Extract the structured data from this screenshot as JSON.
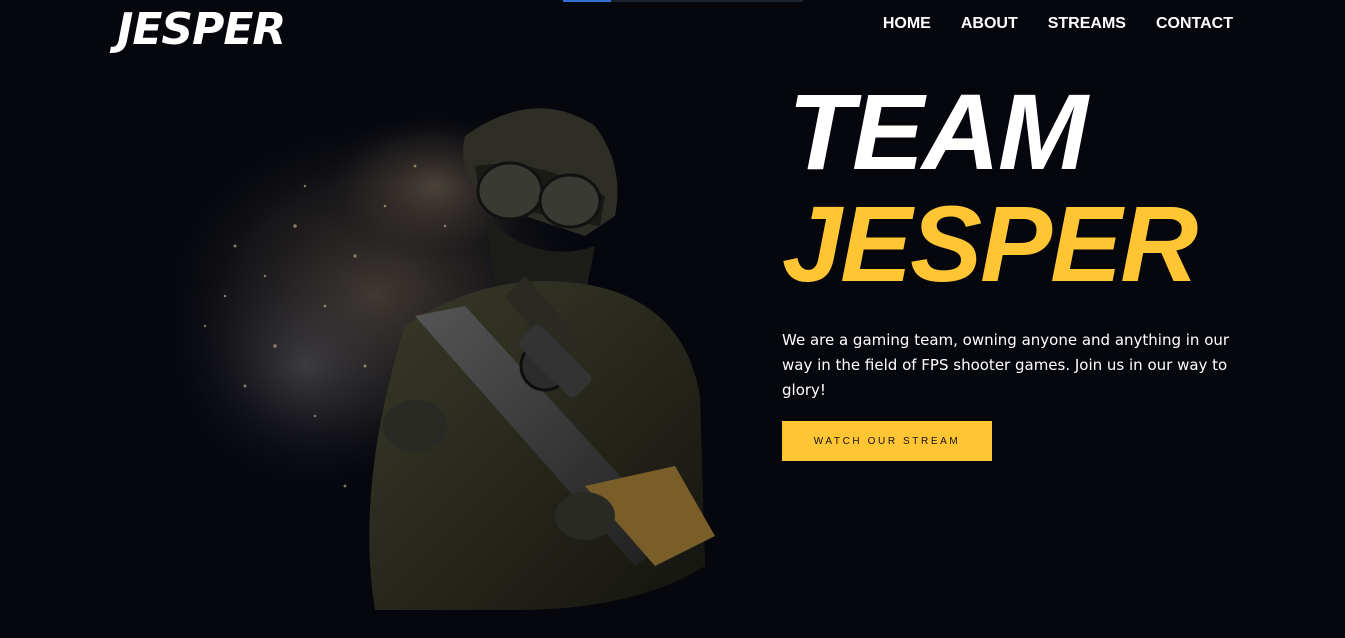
{
  "brand": {
    "logo_text": "JESPER"
  },
  "nav": {
    "items": [
      {
        "label": "HOME"
      },
      {
        "label": "ABOUT"
      },
      {
        "label": "STREAMS"
      },
      {
        "label": "CONTACT"
      }
    ]
  },
  "hero": {
    "headline_line1": "TEAM",
    "headline_line2": "JESPER",
    "description": "We are a gaming team, owning anyone and anything in our way in the field of FPS shooter games. Join us in our way to glory!",
    "cta_label": "WATCH OUR STREAM",
    "image_icon": "soldier-image"
  },
  "colors": {
    "background": "#05070d",
    "accent_yellow": "#ffc532",
    "text_white": "#ffffff",
    "scroll_indicator": "#2f6fd6"
  }
}
